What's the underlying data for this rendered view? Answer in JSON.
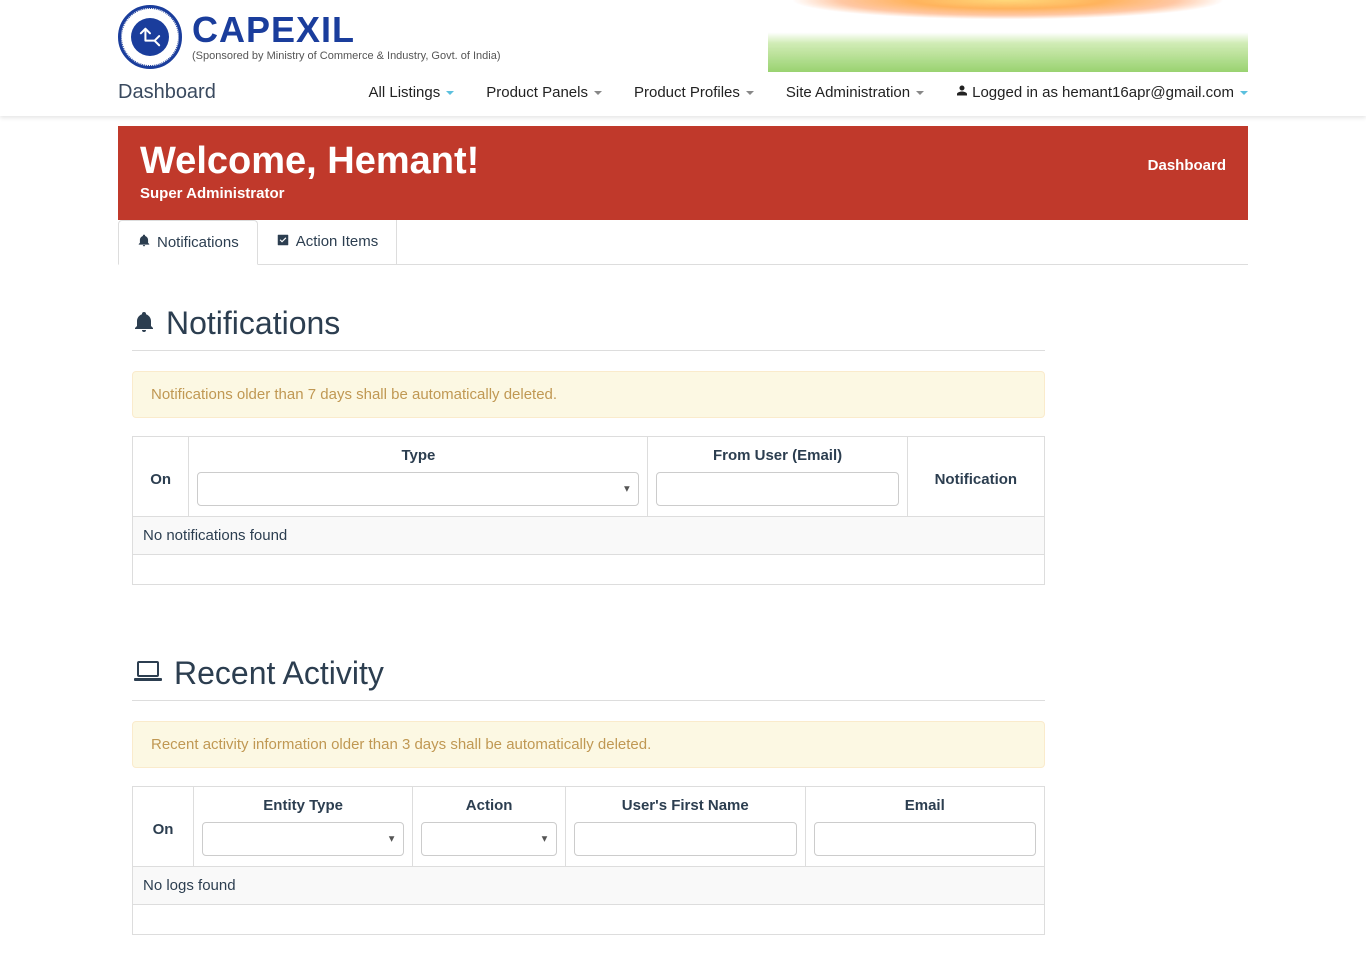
{
  "brand": {
    "title": "CAPEXIL",
    "subtitle": "(Sponsored by Ministry of Commerce & Industry, Govt. of India)"
  },
  "nav": {
    "dashboard": "Dashboard",
    "items": [
      {
        "label": "All Listings"
      },
      {
        "label": "Product Panels"
      },
      {
        "label": "Product Profiles"
      },
      {
        "label": "Site Administration"
      }
    ],
    "logged_in_prefix": "Logged in as ",
    "logged_in_user": "hemant16apr@gmail.com"
  },
  "welcome": {
    "title": "Welcome, Hemant!",
    "role": "Super Administrator",
    "breadcrumb": "Dashboard"
  },
  "tabs": {
    "notifications": "Notifications",
    "action_items": "Action Items"
  },
  "notifications": {
    "heading": "Notifications",
    "alert": "Notifications older than 7 days shall be automatically deleted.",
    "columns": {
      "on": "On",
      "type": "Type",
      "from_user": "From User (Email)",
      "notification": "Notification"
    },
    "empty": "No notifications found"
  },
  "recent_activity": {
    "heading": "Recent Activity",
    "alert": "Recent activity information older than 3 days shall be automatically deleted.",
    "columns": {
      "on": "On",
      "entity_type": "Entity Type",
      "action": "Action",
      "user_first_name": "User's First Name",
      "email": "Email"
    },
    "empty": "No logs found"
  }
}
